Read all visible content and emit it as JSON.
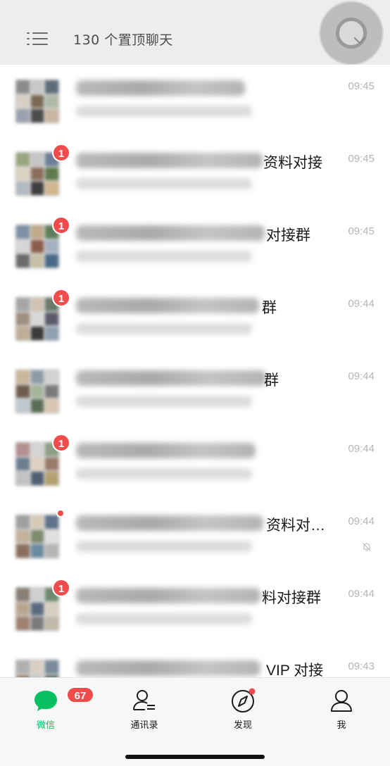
{
  "header": {
    "title": "130 个置顶聊天",
    "menu_icon": "list-menu-icon",
    "float_button_icon": "floating-window-icon"
  },
  "chats": [
    {
      "name_visible": "",
      "time": "09:45",
      "badge": "",
      "has_dot": false,
      "muted": false
    },
    {
      "name_visible": "资料对接",
      "time": "09:45",
      "badge": "1",
      "has_dot": false,
      "muted": false
    },
    {
      "name_visible": "对接群",
      "time": "09:45",
      "badge": "1",
      "has_dot": false,
      "muted": false
    },
    {
      "name_visible": "群",
      "time": "09:44",
      "badge": "1",
      "has_dot": false,
      "muted": false
    },
    {
      "name_visible": "群",
      "time": "09:44",
      "badge": "",
      "has_dot": false,
      "muted": false
    },
    {
      "name_visible": "",
      "time": "09:44",
      "badge": "1",
      "has_dot": false,
      "muted": false
    },
    {
      "name_visible": "资料对…",
      "time": "09:44",
      "badge": "",
      "has_dot": true,
      "muted": true
    },
    {
      "name_visible": "料对接群",
      "time": "09:44",
      "badge": "1",
      "has_dot": false,
      "muted": false
    },
    {
      "name_visible": "VIP 对接",
      "time": "09:43",
      "badge": "",
      "has_dot": false,
      "muted": false
    }
  ],
  "tabbar": {
    "tabs": [
      {
        "label": "微信",
        "icon": "chat-bubble-icon",
        "badge": "67",
        "active": true
      },
      {
        "label": "通讯录",
        "icon": "contacts-icon",
        "badge": "",
        "active": false
      },
      {
        "label": "发现",
        "icon": "compass-icon",
        "badge": "",
        "active": false,
        "has_dot": true
      },
      {
        "label": "我",
        "icon": "person-icon",
        "badge": "",
        "active": false
      }
    ]
  },
  "colors": {
    "accent_green": "#07c160",
    "badge_red": "#f04c4c",
    "header_bg": "#ededed",
    "time_gray": "#b5b5b5"
  }
}
